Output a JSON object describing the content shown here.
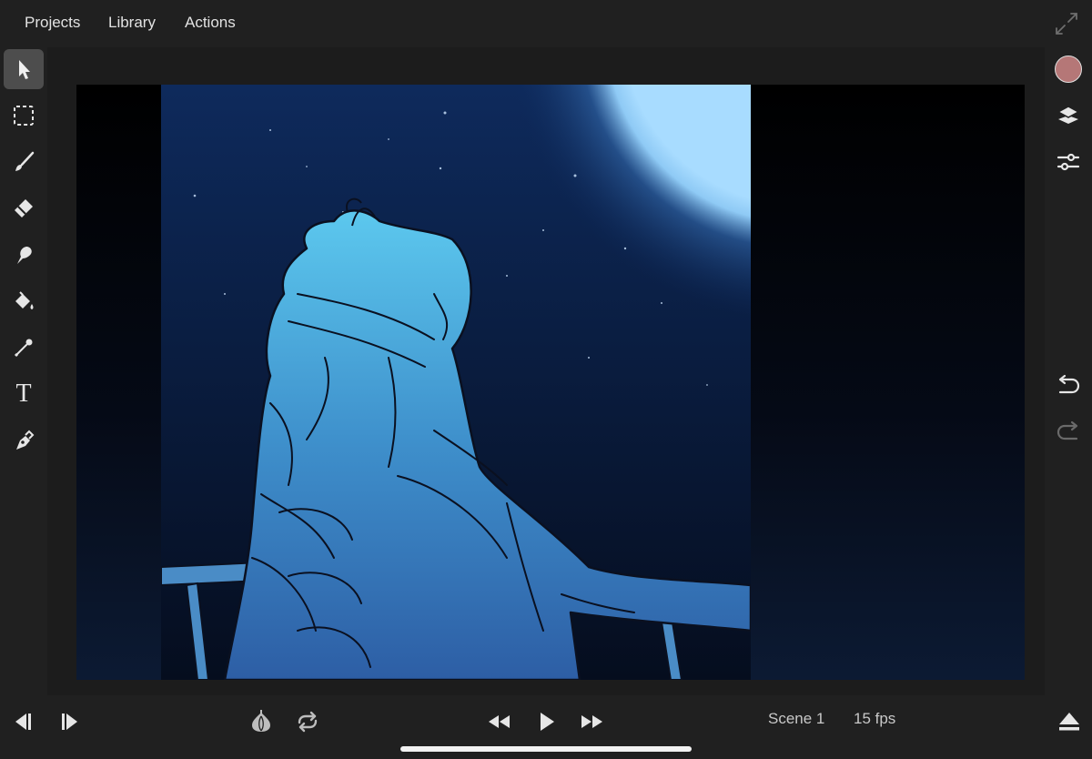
{
  "menu": {
    "projects": "Projects",
    "library": "Library",
    "actions": "Actions"
  },
  "tools": {
    "items": [
      "select-arrow",
      "marquee-select",
      "brush",
      "eraser",
      "smudge",
      "fill-bucket",
      "eyedropper",
      "text",
      "pen"
    ],
    "text_glyph": "T",
    "active": "select-arrow"
  },
  "right_panel": {
    "color_swatch": "#b57777",
    "icons": [
      "layers",
      "adjustments",
      "undo",
      "redo"
    ]
  },
  "playback": {
    "scene_label": "Scene 1",
    "fps_label": "15 fps"
  },
  "colors": {
    "bar_bg": "#202020",
    "active_tool_bg": "#4d4d4d",
    "icon": "#e6e6e6",
    "disabled_icon": "#6a6a6a"
  }
}
